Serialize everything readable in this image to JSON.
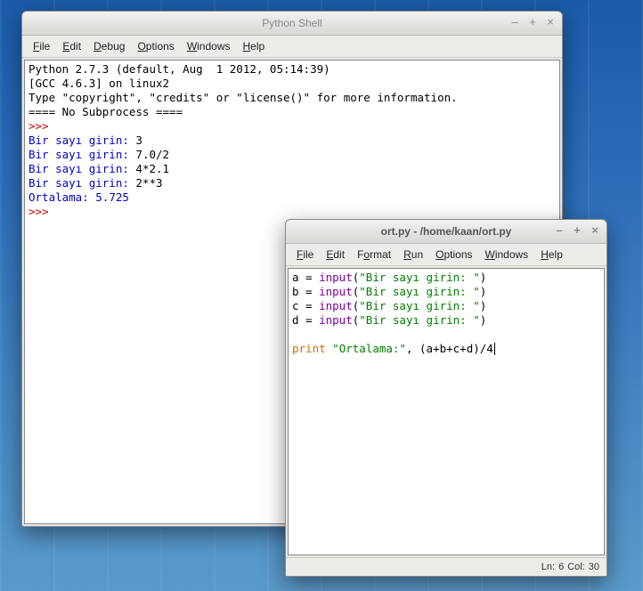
{
  "shell_window": {
    "title": "Python Shell",
    "menubar": [
      "File",
      "Edit",
      "Debug",
      "Options",
      "Windows",
      "Help"
    ],
    "banner1": "Python 2.7.3 (default, Aug  1 2012, 05:14:39)",
    "banner2": "[GCC 4.6.3] on linux2",
    "banner3": "Type \"copyright\", \"credits\" or \"license()\" for more information.",
    "banner4": "==== No Subprocess ====",
    "prompt_line": ">>>",
    "inputs": [
      {
        "prompt": "Bir sayı girin: ",
        "value": "3"
      },
      {
        "prompt": "Bir sayı girin: ",
        "value": "7.0/2"
      },
      {
        "prompt": "Bir sayı girin: ",
        "value": "4*2.1"
      },
      {
        "prompt": "Bir sayı girin: ",
        "value": "2**3"
      }
    ],
    "result_label": "Ortalama: ",
    "result_value": "5.725"
  },
  "editor_window": {
    "title": "ort.py - /home/kaan/ort.py",
    "menubar": [
      "File",
      "Edit",
      "Format",
      "Run",
      "Options",
      "Windows",
      "Help"
    ],
    "lines": {
      "a_var": "a",
      "b_var": "b",
      "c_var": "c",
      "d_var": "d",
      "eq": " = ",
      "input_fn": "input",
      "paren_open": "(",
      "paren_close": ")",
      "string_literal": "\"Bir sayı girin: \"",
      "blank": "",
      "print_kw": "print",
      "space": " ",
      "ort_string": "\"Ortalama:\"",
      "comma": ", ",
      "expr": "(a+b+c+d)/4"
    },
    "status": {
      "ln_label": "Ln:",
      "ln": "6",
      "col_label": "Col:",
      "col": "30"
    }
  },
  "glyphs": {
    "min": "–",
    "plus": "+",
    "close": "×"
  }
}
